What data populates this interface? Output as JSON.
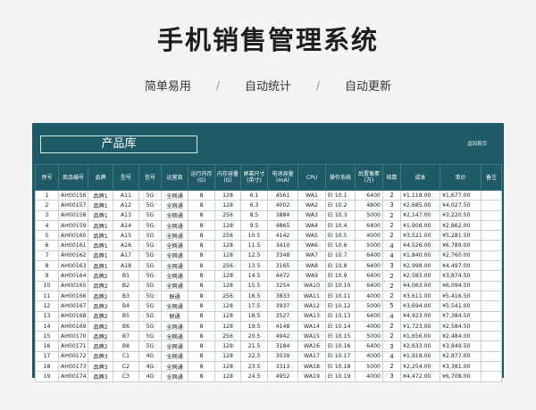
{
  "page": {
    "title": "手机销售管理系统",
    "subtitle_items": [
      "简单易用",
      "自动统计",
      "自动更新"
    ]
  },
  "sheet": {
    "banner_title": "产品库",
    "banner_link": "返回首页",
    "columns": [
      "序号",
      "商品编号",
      "品牌",
      "型号",
      "信号",
      "运营商",
      "运行内存(G)",
      "内存容量(G)",
      "屏幕尺寸(英寸)",
      "电池容量(mA)",
      "CPU",
      "操作系统",
      "后置像素(万)",
      "核数",
      "成本",
      "单价",
      "备注"
    ],
    "rows": [
      [
        "1",
        "AH00156",
        "品牌1",
        "A11",
        "5G",
        "全网通",
        "8",
        "128",
        "6.1",
        "4561",
        "WA1",
        "EI 10.1",
        "6400",
        "2",
        "¥1,118.00",
        "¥1,677.00",
        ""
      ],
      [
        "2",
        "AH00157",
        "品牌1",
        "A12",
        "5G",
        "全网通",
        "8",
        "128",
        "6.3",
        "4002",
        "WA2",
        "EI 10.2",
        "4800",
        "3",
        "¥2,685.00",
        "¥4,027.50",
        ""
      ],
      [
        "3",
        "AH00158",
        "品牌1",
        "A13",
        "5G",
        "全网通",
        "8",
        "256",
        "8.5",
        "3884",
        "WA3",
        "EI 10.3",
        "5000",
        "2",
        "¥2,147.00",
        "¥3,220.50",
        ""
      ],
      [
        "4",
        "AH00159",
        "品牌1",
        "A14",
        "5G",
        "全网通",
        "8",
        "128",
        "9.5",
        "4865",
        "WA4",
        "EI 10.4",
        "6400",
        "2",
        "¥1,908.00",
        "¥2,862.00",
        ""
      ],
      [
        "5",
        "AH00160",
        "品牌1",
        "A15",
        "5G",
        "全网通",
        "8",
        "256",
        "10.5",
        "4142",
        "WA5",
        "EI 10.5",
        "4000",
        "2",
        "¥3,521.00",
        "¥5,281.50",
        ""
      ],
      [
        "6",
        "AH00161",
        "品牌1",
        "A16",
        "5G",
        "全网通",
        "8",
        "128",
        "11.5",
        "3410",
        "WA6",
        "EI 10.6",
        "5000",
        "4",
        "¥4,526.00",
        "¥6,789.00",
        ""
      ],
      [
        "7",
        "AH00162",
        "品牌1",
        "A17",
        "5G",
        "全网通",
        "8",
        "128",
        "12.5",
        "3348",
        "WA7",
        "EI 10.7",
        "6400",
        "4",
        "¥1,840.00",
        "¥2,760.00",
        ""
      ],
      [
        "8",
        "AH00163",
        "品牌1",
        "A18",
        "5G",
        "全网通",
        "8",
        "256",
        "13.5",
        "3165",
        "WA8",
        "EI 10.8",
        "6400",
        "3",
        "¥2,998.00",
        "¥4,497.00",
        ""
      ],
      [
        "9",
        "AH00164",
        "品牌2",
        "B1",
        "5G",
        "全网通",
        "8",
        "128",
        "14.5",
        "4472",
        "WA9",
        "EI 10.9",
        "6400",
        "2",
        "¥2,583.00",
        "¥3,874.50",
        ""
      ],
      [
        "10",
        "AH00165",
        "品牌2",
        "B2",
        "5G",
        "全网通",
        "8",
        "128",
        "15.5",
        "3254",
        "WA10",
        "EI 10.10",
        "6400",
        "2",
        "¥4,063.00",
        "¥6,094.50",
        ""
      ],
      [
        "11",
        "AH00166",
        "品牌2",
        "B3",
        "5G",
        "联通",
        "8",
        "256",
        "16.5",
        "3833",
        "WA11",
        "EI 10.11",
        "4000",
        "2",
        "¥3,611.00",
        "¥5,416.50",
        ""
      ],
      [
        "12",
        "AH00167",
        "品牌2",
        "B4",
        "5G",
        "全网通",
        "8",
        "128",
        "17.5",
        "3937",
        "WA12",
        "EI 10.12",
        "5000",
        "5",
        "¥3,694.00",
        "¥5,541.00",
        ""
      ],
      [
        "13",
        "AH00168",
        "品牌2",
        "B5",
        "5G",
        "联通",
        "8",
        "128",
        "18.5",
        "3527",
        "WA13",
        "EI 10.13",
        "6400",
        "4",
        "¥4,923.00",
        "¥7,384.50",
        ""
      ],
      [
        "14",
        "AH00169",
        "品牌2",
        "B6",
        "5G",
        "全网通",
        "8",
        "128",
        "19.5",
        "4148",
        "WA14",
        "EI 10.14",
        "4000",
        "2",
        "¥1,723.00",
        "¥2,584.50",
        ""
      ],
      [
        "15",
        "AH00170",
        "品牌2",
        "B7",
        "5G",
        "全网通",
        "8",
        "256",
        "20.5",
        "4942",
        "WA15",
        "EI 10.15",
        "5000",
        "2",
        "¥1,656.00",
        "¥2,484.00",
        ""
      ],
      [
        "16",
        "AH00171",
        "品牌2",
        "B8",
        "5G",
        "全网通",
        "8",
        "128",
        "21.5",
        "3184",
        "WA16",
        "EI 10.16",
        "6400",
        "3",
        "¥2,633.00",
        "¥3,949.50",
        ""
      ],
      [
        "17",
        "AH00172",
        "品牌3",
        "C1",
        "4G",
        "全网通",
        "8",
        "128",
        "22.5",
        "3039",
        "WA17",
        "EI 10.17",
        "4000",
        "4",
        "¥1,918.00",
        "¥2,877.00",
        ""
      ],
      [
        "18",
        "AH00173",
        "品牌3",
        "C2",
        "4G",
        "全网通",
        "8",
        "128",
        "23.5",
        "3313",
        "WA18",
        "EI 10.18",
        "5000",
        "2",
        "¥2,254.00",
        "¥3,381.00",
        ""
      ],
      [
        "19",
        "AH00174",
        "品牌3",
        "C3",
        "4G",
        "全网通",
        "8",
        "128",
        "24.5",
        "4952",
        "WA19",
        "EI 10.19",
        "4000",
        "3",
        "¥4,472.00",
        "¥6,708.00",
        ""
      ]
    ]
  },
  "colors": {
    "sheet_bg": "#1f5b66",
    "page_bg": "#f4f4f4"
  }
}
